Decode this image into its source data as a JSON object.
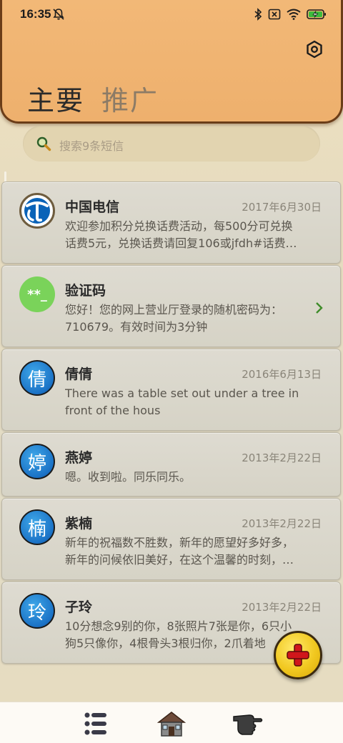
{
  "status_bar": {
    "time": "16:35"
  },
  "header": {
    "tabs": [
      {
        "label": "主要"
      },
      {
        "label": "推广"
      }
    ]
  },
  "search": {
    "placeholder": "搜索9条短信"
  },
  "conversations": [
    {
      "name": "中国电信",
      "date": "2017年6月30日",
      "line1": "欢迎参加积分兑换话费活动，每500分可兑换",
      "line2": "话费5元，兑换话费请回复106或jfdh#话费…",
      "avatar": "telecom-logo"
    },
    {
      "name": "验证码",
      "date": "",
      "line1": "您好！您的网上营业厅登录的随机密码为：",
      "line2": "710679。有效时间为3分钟",
      "avatar": "**_"
    },
    {
      "name": "倩倩",
      "date": "2016年6月13日",
      "line1": "There was a table set out under a tree in",
      "line2": "front of the hous",
      "avatar": "倩"
    },
    {
      "name": "燕婷",
      "date": "2013年2月22日",
      "line1": "嗯。收到啦。同乐同乐。",
      "line2": "",
      "avatar": "婷"
    },
    {
      "name": "紫楠",
      "date": "2013年2月22日",
      "line1": "新年的祝福数不胜数，新年的愿望好多好多，",
      "line2": "新年的问候依旧美好，在这个温馨的时刻，…",
      "avatar": "楠"
    },
    {
      "name": "子玲",
      "date": "2013年2月22日",
      "line1": "10分想念9别的你，8张照片7张是你，6只小",
      "line2": "狗5只像你，4根骨头3根归你，2爪着地",
      "avatar": "玲"
    }
  ],
  "colors": {
    "header": "#eeb06d",
    "avatar_blue": "#1b72c6",
    "avatar_green": "#7ad35a",
    "fab": "#f1c820",
    "fab_plus": "#d0161b"
  },
  "icons": {
    "fab": "add-icon",
    "nav": [
      "list-icon",
      "house-icon",
      "pointing-hand-icon"
    ]
  }
}
